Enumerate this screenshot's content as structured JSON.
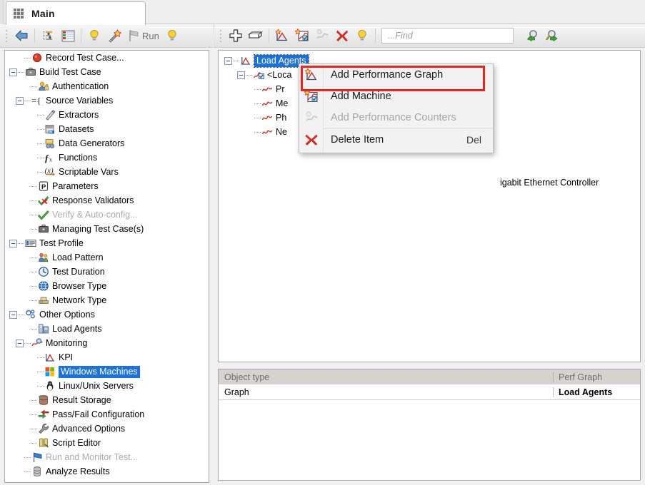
{
  "window": {
    "tab": {
      "label": "Main",
      "icon": "grid-icon"
    }
  },
  "toolbar_left": {
    "buttons": [
      {
        "name": "back-arrow",
        "icon": "back-arrow-icon",
        "label": ""
      },
      {
        "name": "tree-view",
        "icon": "tree-settings-icon",
        "label": ""
      },
      {
        "name": "list-view",
        "icon": "list-grid-icon",
        "label": ""
      },
      {
        "name": "hint-bulb-1",
        "icon": "lightbulb-icon",
        "label": ""
      },
      {
        "name": "wizard",
        "icon": "magic-wand-icon",
        "label": ""
      },
      {
        "name": "run",
        "icon": "flag-icon",
        "label": "Run"
      },
      {
        "name": "hint-bulb-2",
        "icon": "lightbulb-icon",
        "label": ""
      }
    ],
    "run_label": "Run"
  },
  "toolbar_right": {
    "buttons": [
      {
        "name": "add-item",
        "icon": "plus-cross-icon"
      },
      {
        "name": "rename-item",
        "icon": "rename-icon"
      },
      {
        "name": "add-performance-graph",
        "icon": "perf-graph-add-icon"
      },
      {
        "name": "add-machine",
        "icon": "machine-add-icon"
      },
      {
        "name": "add-performance-counters",
        "icon": "perf-counter-icon"
      },
      {
        "name": "delete-item",
        "icon": "red-x-icon"
      },
      {
        "name": "hint-bulb",
        "icon": "lightbulb-icon"
      },
      {
        "name": "find-previous",
        "icon": "search-back-icon"
      },
      {
        "name": "find-next",
        "icon": "search-forward-icon"
      }
    ],
    "find": {
      "placeholder": "...Find",
      "value": ""
    }
  },
  "sidebar": {
    "items": [
      {
        "label": "Record Test Case...",
        "depth": 1,
        "icon": "record-circle-icon",
        "expander": "none",
        "state": "normal"
      },
      {
        "label": "Build Test Case",
        "depth": 0,
        "icon": "briefcase-icon",
        "expander": "expanded",
        "state": "normal"
      },
      {
        "label": "Authentication",
        "depth": 2,
        "icon": "authentication-icon",
        "expander": "none",
        "state": "normal"
      },
      {
        "label": "Source Variables",
        "depth": 1,
        "icon": "source-variables-icon",
        "expander": "expanded",
        "state": "normal"
      },
      {
        "label": "Extractors",
        "depth": 3,
        "icon": "extractors-icon",
        "expander": "none",
        "state": "normal"
      },
      {
        "label": "Datasets",
        "depth": 3,
        "icon": "datasets-icon",
        "expander": "none",
        "state": "normal"
      },
      {
        "label": "Data Generators",
        "depth": 3,
        "icon": "data-generators-icon",
        "expander": "none",
        "state": "normal"
      },
      {
        "label": "Functions",
        "depth": 3,
        "icon": "functions-icon",
        "expander": "none",
        "state": "normal"
      },
      {
        "label": "Scriptable Vars",
        "depth": 3,
        "icon": "scriptable-vars-icon",
        "expander": "none",
        "state": "normal"
      },
      {
        "label": "Parameters",
        "depth": 2,
        "icon": "parameters-icon",
        "expander": "none",
        "state": "normal"
      },
      {
        "label": "Response Validators",
        "depth": 2,
        "icon": "response-validators-icon",
        "expander": "none",
        "state": "normal"
      },
      {
        "label": "Verify & Auto-config...",
        "depth": 2,
        "icon": "verify-check-icon",
        "expander": "none",
        "state": "disabled"
      },
      {
        "label": "Managing Test Case(s)",
        "depth": 2,
        "icon": "managing-briefcase-icon",
        "expander": "none",
        "state": "normal"
      },
      {
        "label": "Test Profile",
        "depth": 0,
        "icon": "test-profile-icon",
        "expander": "expanded",
        "state": "normal"
      },
      {
        "label": "Load Pattern",
        "depth": 2,
        "icon": "load-pattern-icon",
        "expander": "none",
        "state": "normal"
      },
      {
        "label": "Test Duration",
        "depth": 2,
        "icon": "clock-icon",
        "expander": "none",
        "state": "normal"
      },
      {
        "label": "Browser Type",
        "depth": 2,
        "icon": "globe-icon",
        "expander": "none",
        "state": "normal"
      },
      {
        "label": "Network Type",
        "depth": 2,
        "icon": "network-type-icon",
        "expander": "none",
        "state": "normal"
      },
      {
        "label": "Other Options",
        "depth": 0,
        "icon": "other-options-icon",
        "expander": "expanded",
        "state": "normal"
      },
      {
        "label": "Load Agents",
        "depth": 2,
        "icon": "load-agents-icon",
        "expander": "none",
        "state": "normal"
      },
      {
        "label": "Monitoring",
        "depth": 1,
        "icon": "monitoring-icon",
        "expander": "expanded",
        "state": "normal"
      },
      {
        "label": "KPI",
        "depth": 3,
        "icon": "kpi-graph-icon",
        "expander": "none",
        "state": "normal"
      },
      {
        "label": "Windows Machines",
        "depth": 3,
        "icon": "windows-logo-icon",
        "expander": "none",
        "state": "selected"
      },
      {
        "label": "Linux/Unix Servers",
        "depth": 3,
        "icon": "penguin-icon",
        "expander": "none",
        "state": "normal"
      },
      {
        "label": "Result Storage",
        "depth": 2,
        "icon": "result-storage-icon",
        "expander": "none",
        "state": "normal"
      },
      {
        "label": "Pass/Fail Configuration",
        "depth": 2,
        "icon": "pass-fail-icon",
        "expander": "none",
        "state": "normal"
      },
      {
        "label": "Advanced Options",
        "depth": 2,
        "icon": "wrench-icon",
        "expander": "none",
        "state": "normal"
      },
      {
        "label": "Script Editor",
        "depth": 2,
        "icon": "script-editor-icon",
        "expander": "none",
        "state": "normal"
      },
      {
        "label": "Run and Monitor Test...",
        "depth": 1,
        "icon": "blue-flag-icon",
        "expander": "none",
        "state": "disabled"
      },
      {
        "label": "Analyze Results",
        "depth": 1,
        "icon": "analyze-results-icon",
        "expander": "none",
        "state": "normal"
      }
    ]
  },
  "main_tree": {
    "nodes": [
      {
        "label": "Load Agents",
        "depth": 0,
        "icon": "perf-graph-icon",
        "expander": "expanded",
        "state": "selected"
      },
      {
        "label": "<Loca",
        "depth": 1,
        "icon": "machine-icon",
        "expander": "expanded",
        "state": "truncated"
      },
      {
        "label": "Pr",
        "depth": 2,
        "icon": "wave-icon",
        "expander": "none",
        "state": "truncated"
      },
      {
        "label": "Me",
        "depth": 2,
        "icon": "wave-icon",
        "expander": "none",
        "state": "truncated"
      },
      {
        "label": "Ph",
        "depth": 2,
        "icon": "wave-icon",
        "expander": "none",
        "state": "truncated"
      },
      {
        "label": "Ne",
        "depth": 2,
        "icon": "wave-icon",
        "expander": "none",
        "state": "truncated"
      }
    ],
    "occluded_tail": "igabit Ethernet Controller"
  },
  "context_menu": {
    "items": [
      {
        "label": "Add Performance Graph",
        "icon": "perf-graph-add-icon",
        "accel": "",
        "state": "highlighted"
      },
      {
        "label": "Add Machine",
        "icon": "machine-add-icon",
        "accel": "",
        "state": "normal"
      },
      {
        "label": "Add Performance Counters",
        "icon": "perf-counter-icon",
        "accel": "",
        "state": "disabled"
      },
      {
        "label": "Delete Item",
        "icon": "red-x-icon",
        "accel": "Del",
        "state": "normal"
      }
    ],
    "highlight_color": "#e8251f"
  },
  "properties_grid": {
    "header": {
      "name": "Object type",
      "value": "Perf Graph"
    },
    "rows": [
      {
        "name": "Graph",
        "value": "Load Agents"
      }
    ]
  },
  "colors": {
    "selection_blue": "#1c72d8",
    "highlight_red": "#e8251f",
    "header_gray": "#d6d3ce",
    "panel_gray": "#f0f0f0"
  }
}
